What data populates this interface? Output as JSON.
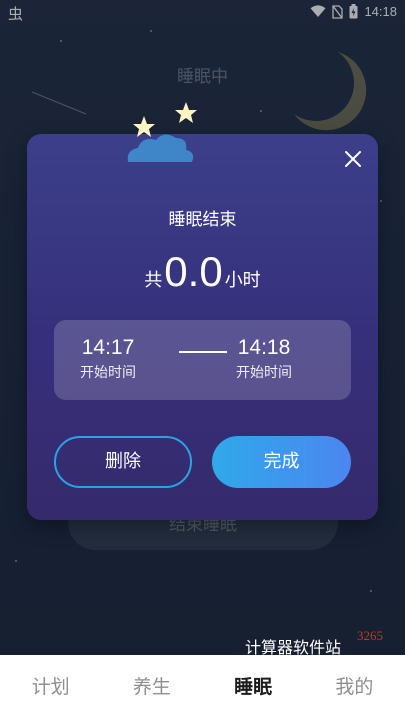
{
  "status_bar": {
    "left_icon": "bug-icon",
    "time": "14:18",
    "icons": [
      "wifi-icon",
      "no-sim-icon",
      "battery-icon"
    ]
  },
  "background": {
    "title": "睡眠中",
    "button_label": "结束睡眠"
  },
  "dialog": {
    "title": "睡眠结束",
    "total_prefix": "共",
    "total_value": "0.0",
    "total_unit": "小时",
    "start_time": "14:17",
    "start_label": "开始时间",
    "end_time": "14:18",
    "end_label": "开始时间",
    "delete_label": "删除",
    "done_label": "完成",
    "close_icon": "close-icon"
  },
  "watermark": {
    "text": "计算器软件站",
    "sub": "3265"
  },
  "tabs": [
    {
      "label": "计划",
      "active": false
    },
    {
      "label": "养生",
      "active": false
    },
    {
      "label": "睡眠",
      "active": true
    },
    {
      "label": "我的",
      "active": false
    }
  ],
  "colors": {
    "accent_blue": "#2aa3e6",
    "dialog_top": "#3c3f8a",
    "dialog_bottom": "#352a6c",
    "moon": "#fbf2c4",
    "star": "#fff4c2"
  }
}
